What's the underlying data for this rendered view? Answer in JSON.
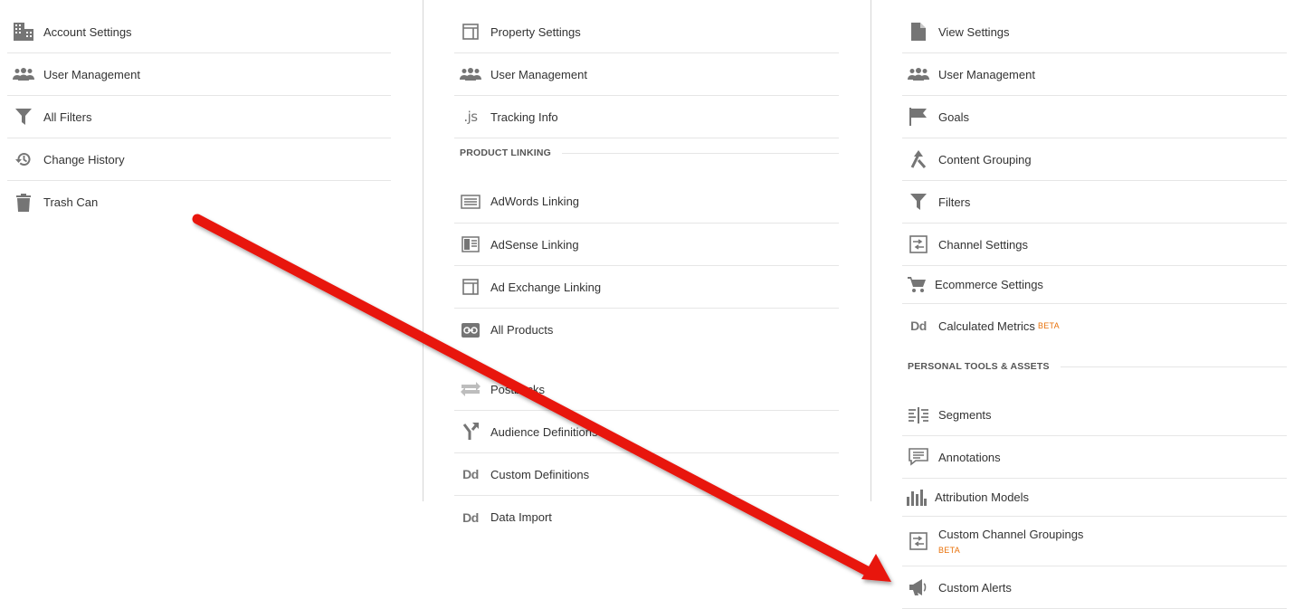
{
  "account": {
    "items": [
      {
        "label": "Account Settings",
        "icon": "building-icon"
      },
      {
        "label": "User Management",
        "icon": "users-icon"
      },
      {
        "label": "All Filters",
        "icon": "filter-icon"
      },
      {
        "label": "Change History",
        "icon": "history-icon"
      },
      {
        "label": "Trash Can",
        "icon": "trash-icon"
      }
    ]
  },
  "property": {
    "items": [
      {
        "label": "Property Settings",
        "icon": "window-icon"
      },
      {
        "label": "User Management",
        "icon": "users-icon"
      },
      {
        "label": "Tracking Info",
        "icon": "js-icon",
        "icon_text": ".js"
      }
    ],
    "product_linking_heading": "PRODUCT LINKING",
    "linking_items": [
      {
        "label": "AdWords Linking",
        "icon": "adwords-icon"
      },
      {
        "label": "AdSense Linking",
        "icon": "adsense-icon"
      },
      {
        "label": "Ad Exchange Linking",
        "icon": "window-icon"
      },
      {
        "label": "All Products",
        "icon": "link-icon"
      }
    ],
    "other_items": [
      {
        "label": "Postbacks",
        "icon": "swap-arrows-icon"
      },
      {
        "label": "Audience Definitions",
        "icon": "fork-icon"
      },
      {
        "label": "Custom Definitions",
        "icon": "dd-icon",
        "icon_text": "Dd"
      },
      {
        "label": "Data Import",
        "icon": "dd-icon",
        "icon_text": "Dd"
      }
    ]
  },
  "view": {
    "items": [
      {
        "label": "View Settings",
        "icon": "document-icon"
      },
      {
        "label": "User Management",
        "icon": "users-icon"
      },
      {
        "label": "Goals",
        "icon": "flag-icon"
      },
      {
        "label": "Content Grouping",
        "icon": "merge-icon"
      },
      {
        "label": "Filters",
        "icon": "filter-icon"
      },
      {
        "label": "Channel Settings",
        "icon": "channel-icon"
      },
      {
        "label": "Ecommerce Settings",
        "icon": "cart-icon"
      },
      {
        "label": "Calculated Metrics",
        "icon": "dd-icon",
        "icon_text": "Dd",
        "badge": "BETA"
      }
    ],
    "personal_heading": "PERSONAL TOOLS & ASSETS",
    "personal_items": [
      {
        "label": "Segments",
        "icon": "segments-icon"
      },
      {
        "label": "Annotations",
        "icon": "comment-icon"
      },
      {
        "label": "Attribution Models",
        "icon": "bar-chart-icon"
      },
      {
        "label": "Custom Channel Groupings",
        "icon": "channel-icon",
        "badge": "BETA"
      },
      {
        "label": "Custom Alerts",
        "icon": "megaphone-icon"
      }
    ]
  },
  "colors": {
    "arrow": "#e8120c",
    "icon": "#757575",
    "beta": "#e8710a",
    "divider": "#e6e6e6"
  }
}
